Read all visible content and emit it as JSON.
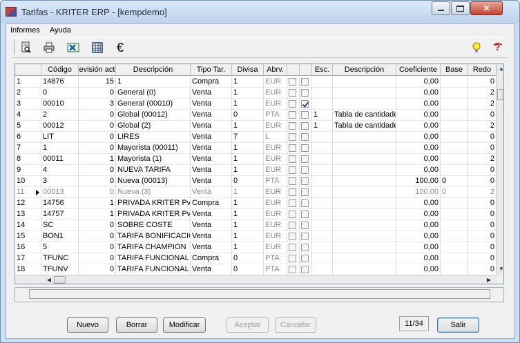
{
  "window": {
    "title": "Tarifas - KRITER ERP - [kempdemo]"
  },
  "menu": {
    "items": [
      "Informes",
      "Ayuda"
    ]
  },
  "toolbar": {
    "buttons": [
      "preview-icon",
      "print-icon",
      "excel-icon",
      "grid-icon",
      "euro-icon"
    ],
    "right_buttons": [
      "lightbulb-icon",
      "help-icon"
    ],
    "euro_glyph": "€"
  },
  "grid": {
    "columns": [
      "",
      "Código",
      "evisión act",
      "Descripción",
      "Tipo Tar.",
      "Divisa",
      "Abrv.",
      "",
      "",
      "Esc.",
      "Descripción",
      "Coeficiente",
      "Base",
      "Redo"
    ],
    "rows": [
      {
        "n": "1",
        "codigo": "14876",
        "rev": "15",
        "desc": "1",
        "tipo": "Compra",
        "divisa": "1",
        "abrv": "EUR",
        "c1": false,
        "c2": false,
        "esc": "",
        "desc2": "",
        "coef": "0,00",
        "base": "",
        "redo": "0"
      },
      {
        "n": "2",
        "codigo": "0",
        "rev": "0",
        "desc": "General (0)",
        "tipo": "Venta",
        "divisa": "1",
        "abrv": "EUR",
        "c1": false,
        "c2": false,
        "esc": "",
        "desc2": "",
        "coef": "0,00",
        "base": "",
        "redo": "2"
      },
      {
        "n": "3",
        "codigo": "00010",
        "rev": "3",
        "desc": "General (00010)",
        "tipo": "Venta",
        "divisa": "1",
        "abrv": "EUR",
        "c1": false,
        "c2": true,
        "esc": "",
        "desc2": "",
        "coef": "0,00",
        "base": "",
        "redo": "2"
      },
      {
        "n": "4",
        "codigo": "2",
        "rev": "0",
        "desc": "Global (00012)",
        "tipo": "Venta",
        "divisa": "0",
        "abrv": "PTA",
        "c1": false,
        "c2": false,
        "esc": "1",
        "desc2": "Tabla de cantidades",
        "coef": "0,00",
        "base": "",
        "redo": "0"
      },
      {
        "n": "5",
        "codigo": "00012",
        "rev": "0",
        "desc": "Global (2)",
        "tipo": "Venta",
        "divisa": "1",
        "abrv": "EUR",
        "c1": false,
        "c2": false,
        "esc": "1",
        "desc2": "Tabla de cantidades",
        "coef": "0,00",
        "base": "",
        "redo": "2"
      },
      {
        "n": "6",
        "codigo": "LIT",
        "rev": "0",
        "desc": "LIRES",
        "tipo": "Venta",
        "divisa": "7",
        "abrv": "L",
        "c1": false,
        "c2": false,
        "esc": "",
        "desc2": "",
        "coef": "0,00",
        "base": "",
        "redo": "0"
      },
      {
        "n": "7",
        "codigo": "1",
        "rev": "0",
        "desc": "Mayorista (00011)",
        "tipo": "Venta",
        "divisa": "1",
        "abrv": "EUR",
        "c1": false,
        "c2": false,
        "esc": "",
        "desc2": "",
        "coef": "0,00",
        "base": "",
        "redo": "0"
      },
      {
        "n": "8",
        "codigo": "00011",
        "rev": "1",
        "desc": "Mayorista (1)",
        "tipo": "Venta",
        "divisa": "1",
        "abrv": "EUR",
        "c1": false,
        "c2": false,
        "esc": "",
        "desc2": "",
        "coef": "0,00",
        "base": "",
        "redo": "2"
      },
      {
        "n": "9",
        "codigo": "4",
        "rev": "0",
        "desc": "NUEVA TARIFA",
        "tipo": "Venta",
        "divisa": "1",
        "abrv": "EUR",
        "c1": false,
        "c2": false,
        "esc": "",
        "desc2": "",
        "coef": "0,00",
        "base": "",
        "redo": "0"
      },
      {
        "n": "10",
        "codigo": "3",
        "rev": "0",
        "desc": "Nueva (00013)",
        "tipo": "Venta",
        "divisa": "0",
        "abrv": "PTA",
        "c1": false,
        "c2": false,
        "esc": "",
        "desc2": "",
        "coef": "100,00",
        "base": "0",
        "redo": "0"
      },
      {
        "n": "11",
        "codigo": "00013",
        "rev": "0",
        "desc": "Nueva (3)",
        "tipo": "Venta",
        "divisa": "1",
        "abrv": "EUR",
        "c1": false,
        "c2": false,
        "esc": "",
        "desc2": "",
        "coef": "100,00",
        "base": "0",
        "redo": "2",
        "current": true
      },
      {
        "n": "12",
        "codigo": "14756",
        "rev": "1",
        "desc": "PRIVADA KRITER Pv",
        "tipo": "Compra",
        "divisa": "1",
        "abrv": "EUR",
        "c1": false,
        "c2": false,
        "esc": "",
        "desc2": "",
        "coef": "0,00",
        "base": "",
        "redo": "0"
      },
      {
        "n": "13",
        "codigo": "14757",
        "rev": "1",
        "desc": "PRIVADA KRITER Pv",
        "tipo": "Venta",
        "divisa": "1",
        "abrv": "EUR",
        "c1": false,
        "c2": false,
        "esc": "",
        "desc2": "",
        "coef": "0,00",
        "base": "",
        "redo": "0"
      },
      {
        "n": "14",
        "codigo": "SC",
        "rev": "0",
        "desc": "SOBRE COSTE",
        "tipo": "Venta",
        "divisa": "1",
        "abrv": "EUR",
        "c1": false,
        "c2": false,
        "esc": "",
        "desc2": "",
        "coef": "0,00",
        "base": "",
        "redo": "0"
      },
      {
        "n": "15",
        "codigo": "BON1",
        "rev": "0",
        "desc": "TARIFA BONIFICACIO",
        "tipo": "Venta",
        "divisa": "1",
        "abrv": "EUR",
        "c1": false,
        "c2": false,
        "esc": "",
        "desc2": "",
        "coef": "0,00",
        "base": "",
        "redo": "0"
      },
      {
        "n": "16",
        "codigo": "5",
        "rev": "0",
        "desc": "TARIFA CHAMPION",
        "tipo": "Venta",
        "divisa": "1",
        "abrv": "EUR",
        "c1": false,
        "c2": false,
        "esc": "",
        "desc2": "",
        "coef": "0,00",
        "base": "",
        "redo": "0"
      },
      {
        "n": "17",
        "codigo": "TFUNC",
        "rev": "0",
        "desc": "TARIFA FUNCIONAL",
        "tipo": "Compra",
        "divisa": "0",
        "abrv": "PTA",
        "c1": false,
        "c2": false,
        "esc": "",
        "desc2": "",
        "coef": "0,00",
        "base": "",
        "redo": "0"
      },
      {
        "n": "18",
        "codigo": "TFUNV",
        "rev": "0",
        "desc": "TARIFA FUNCIONAL",
        "tipo": "Venta",
        "divisa": "0",
        "abrv": "PTA",
        "c1": false,
        "c2": false,
        "esc": "",
        "desc2": "",
        "coef": "0,00",
        "base": "",
        "redo": "0"
      }
    ]
  },
  "buttons": {
    "nuevo": "Nuevo",
    "borrar": "Borrar",
    "modificar": "Modificar",
    "aceptar": "Aceptar",
    "cancelar": "Cancelar",
    "salir": "Salir"
  },
  "pager": {
    "text": "11/34"
  }
}
